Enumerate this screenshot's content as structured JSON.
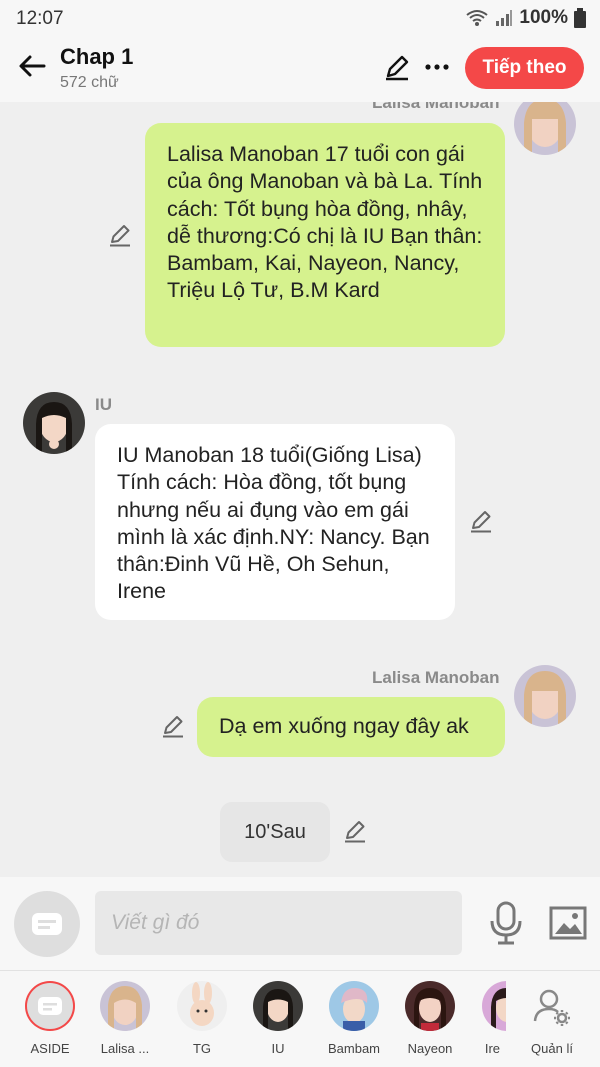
{
  "status": {
    "time": "12:07",
    "battery": "100%"
  },
  "header": {
    "title": "Chap 1",
    "subtitle": "572 chữ",
    "next_label": "Tiếp theo"
  },
  "messages": [
    {
      "sender": "Lalisa Manoban",
      "side": "right",
      "text": "Lalisa Manoban 17 tuổi con gái của ông Manoban và bà La. Tính cách: Tốt bụng hòa đồng, nhây, dễ thương:Có chị là IU Bạn thân: Bambam, Kai, Nayeon, Nancy, Triệu Lộ Tư, B.M Kard"
    },
    {
      "sender": "IU",
      "side": "left",
      "text": "IU Manoban 18 tuổi(Giống Lisa) Tính cách: Hòa đồng, tốt bụng nhưng nếu ai đụng vào em gái mình là xác định.NY: Nancy. Bạn thân:Đinh Vũ Hề, Oh Sehun, Irene"
    },
    {
      "sender": "Lalisa Manoban",
      "side": "right",
      "text": "Dạ em xuống ngay đây ak"
    }
  ],
  "aside_chip": "10'Sau",
  "composer": {
    "placeholder": "Viết gì đó"
  },
  "tabs": [
    {
      "label": "ASIDE"
    },
    {
      "label": "Lalisa ..."
    },
    {
      "label": "TG"
    },
    {
      "label": "IU"
    },
    {
      "label": "Bambam"
    },
    {
      "label": "Nayeon"
    },
    {
      "label": "Ire"
    },
    {
      "label": "Quản lí"
    }
  ],
  "colors": {
    "accent": "#f44848",
    "bubble_green": "#d6f28e",
    "bubble_white": "#ffffff"
  },
  "icons": [
    "back-arrow-icon",
    "pencil-icon",
    "more-icon",
    "wifi-icon",
    "signal-icon",
    "battery-icon",
    "mic-icon",
    "image-icon",
    "chat-icon",
    "settings-user-icon"
  ]
}
